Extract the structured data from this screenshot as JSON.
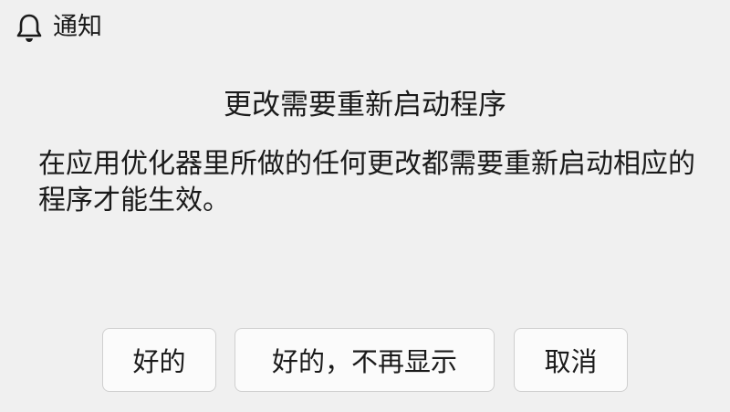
{
  "window": {
    "title": "通知",
    "icon": "bell-icon"
  },
  "dialog": {
    "heading": "更改需要重新启动程序",
    "message": "在应用优化器里所做的任何更改都需要重新启动相应的程序才能生效。"
  },
  "buttons": {
    "ok": "好的",
    "ok_no_more": "好的，不再显示",
    "cancel": "取消"
  }
}
